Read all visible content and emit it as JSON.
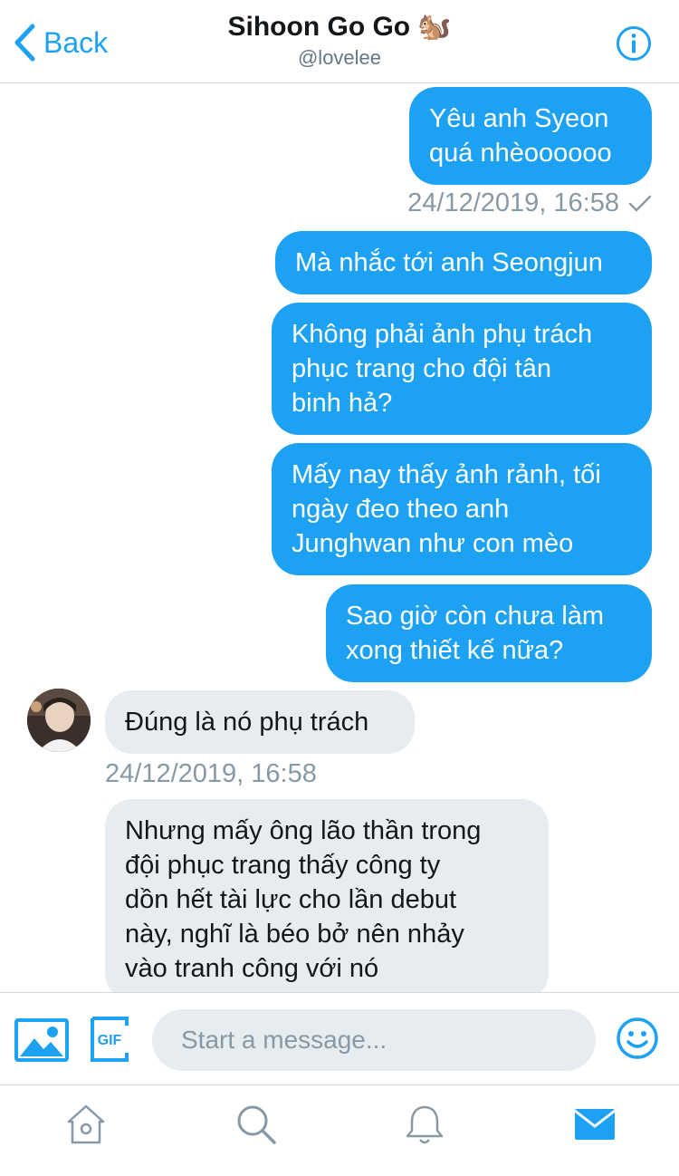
{
  "header": {
    "back_label": "Back",
    "title": "Sihoon Go Go",
    "title_emoji": "🐿️",
    "handle": "@lovelee"
  },
  "messages": [
    {
      "direction": "outgoing",
      "text": "Yêu anh Syeon\nquá nhèoooooo"
    },
    {
      "direction": "outgoing",
      "timestamp": "24/12/2019, 16:58",
      "status": "sent-check"
    },
    {
      "direction": "outgoing",
      "text": "Mà nhắc tới anh Seongjun"
    },
    {
      "direction": "outgoing",
      "text": "Không phải ảnh phụ trách\nphục trang cho đội tân\nbinh hả?"
    },
    {
      "direction": "outgoing",
      "text": "Mấy nay thấy ảnh rảnh, tối\nngày đeo theo anh\nJunghwan như con mèo"
    },
    {
      "direction": "outgoing",
      "text": "Sao giờ còn chưa làm\nxong thiết kế nữa?"
    },
    {
      "direction": "incoming",
      "text": "Đúng là nó phụ trách"
    },
    {
      "direction": "incoming",
      "timestamp": "24/12/2019, 16:58"
    },
    {
      "direction": "incoming",
      "text": "Nhưng mấy ông lão thần trong\nđội phục trang thấy công ty\ndồn hết tài lực cho lần debut\nnày, nghĩ là béo bở nên nhảy\nvào tranh công với nó"
    }
  ],
  "composer": {
    "placeholder": "Start a message...",
    "gif_label": "GIF"
  },
  "tabbar": {
    "items": [
      "home-icon",
      "search-icon",
      "bell-icon",
      "mail-icon"
    ],
    "active": "mail-icon"
  },
  "colors": {
    "accent": "#1da1f2",
    "incoming_bubble": "#e6ecf0",
    "muted": "#8899a6"
  }
}
